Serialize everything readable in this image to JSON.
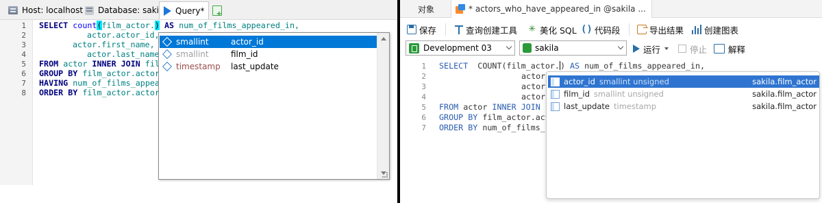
{
  "left_pane": {
    "tabs": {
      "host": "Host: localhost",
      "database": "Database: sakila",
      "query": "Query*"
    },
    "editor": {
      "line_numbers": [
        "1",
        "2",
        "3",
        "4",
        "5",
        "6",
        "7",
        "8"
      ],
      "lines": [
        {
          "a": "SELECT ",
          "b": "count",
          "c": "(",
          "d": "film_actor.",
          "e": ")",
          "f": " AS ",
          "g": "num_of_films_appeared_in,"
        },
        {
          "text": "actor.actor_id,"
        },
        {
          "text": "actor.first_name,"
        },
        {
          "text": "actor.last_name"
        },
        {
          "k1": "FROM ",
          "t1": "actor ",
          "k2": "INNER JOIN ",
          "t2": "fil"
        },
        {
          "k1": "GROUP BY ",
          "t1": "film_actor.actor"
        },
        {
          "k1": "HAVING ",
          "t1": "num_of_films_appea"
        },
        {
          "k1": "ORDER BY ",
          "t1": "film_actor.actor"
        }
      ]
    },
    "autocomplete": {
      "items": [
        {
          "type": "smallint",
          "name": "actor_id",
          "selected": true
        },
        {
          "type": "smallint",
          "name": "film_id",
          "selected": false
        },
        {
          "type": "timestamp",
          "name": "last_update",
          "selected": false
        }
      ]
    }
  },
  "right_pane": {
    "tabs": {
      "objects": "对象",
      "query": "* actors_who_have_appeared_in @sakila ..."
    },
    "toolbar": {
      "save": "保存",
      "query_builder": "查询创建工具",
      "beautify": "美化 SQL",
      "snippet": "代码段",
      "export": "导出结果",
      "create_chart": "创建图表"
    },
    "toolbar2": {
      "connection": "Development 03",
      "database": "sakila",
      "run": "运行",
      "stop": "停止",
      "explain": "解释"
    },
    "editor": {
      "line_numbers": [
        "1",
        "2",
        "3",
        "4",
        "5",
        "6",
        "7"
      ],
      "line1": {
        "k1": "SELECT",
        "mid": "  COUNT(film_actor.",
        "end": ") ",
        "k2": "AS",
        "tail": " num_of_films_appeared_in,"
      },
      "line2": "actor",
      "line3": "actor",
      "line4": "actor",
      "line5": {
        "k1": "FROM",
        "t1": " actor ",
        "k2": "INNER JOIN"
      },
      "line6": {
        "k1": "GROUP BY",
        "t1": " film_actor.act"
      },
      "line7": {
        "k1": "ORDER BY",
        "t1": " num_of_films_"
      }
    },
    "autocomplete": {
      "items": [
        {
          "name": "actor_id",
          "type": "smallint unsigned",
          "source": "sakila.film_actor",
          "selected": true
        },
        {
          "name": "film_id",
          "type": "smallint unsigned",
          "source": "sakila.film_actor",
          "selected": false
        },
        {
          "name": "last_update",
          "type": "timestamp",
          "source": "sakila.film_actor",
          "selected": false
        }
      ]
    }
  }
}
